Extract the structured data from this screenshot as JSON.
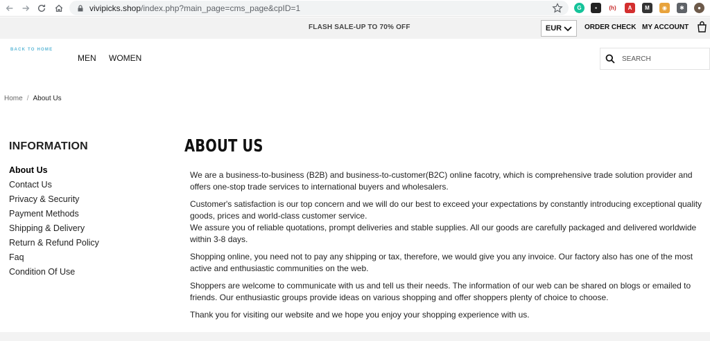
{
  "browser": {
    "url_host": "vivipicks.shop",
    "url_path": "/index.php?main_page=cms_page&cpID=1",
    "extensions": [
      {
        "name": "grammarly-icon",
        "color": "#15c39a",
        "glyph": "G"
      },
      {
        "name": "extension-icon-dark",
        "color": "#222222",
        "glyph": "▪"
      },
      {
        "name": "extension-icon-red-text",
        "color": "#ffffff",
        "glyph": "(h)"
      },
      {
        "name": "pdf-icon",
        "color": "#d32f2f",
        "glyph": "A"
      },
      {
        "name": "m-extension-icon",
        "color": "#333333",
        "glyph": "M"
      },
      {
        "name": "extension-icon-circle",
        "color": "#e8a33c",
        "glyph": "◉"
      },
      {
        "name": "puzzle-extensions-icon",
        "color": "#5f6368",
        "glyph": "✱"
      },
      {
        "name": "profile-avatar-icon",
        "color": "#6d5a4a",
        "glyph": "●"
      }
    ]
  },
  "topbar": {
    "flash_sale": "FLASH SALE-UP TO 70% OFF",
    "currency": "EUR",
    "order_check": "ORDER CHECK",
    "my_account": "MY ACCOUNT"
  },
  "header": {
    "logo_text": "BACK TO HOME",
    "nav": [
      "MEN",
      "WOMEN"
    ],
    "search_placeholder": "SEARCH"
  },
  "breadcrumb": {
    "home": "Home",
    "separator": "/",
    "current": "About Us"
  },
  "sidebar": {
    "title": "INFORMATION",
    "items": [
      {
        "label": "About Us",
        "active": true
      },
      {
        "label": "Contact Us"
      },
      {
        "label": "Privacy & Security"
      },
      {
        "label": "Payment Methods"
      },
      {
        "label": "Shipping & Delivery"
      },
      {
        "label": "Return & Refund Policy"
      },
      {
        "label": "Faq"
      },
      {
        "label": "Condition Of Use"
      }
    ]
  },
  "content": {
    "heading": "ABOUT US",
    "paragraphs": [
      "We are a business-to-business (B2B) and business-to-customer(B2C) online facotry, which is comprehensive trade solution provider and offers one-stop trade services to international buyers and wholesalers.",
      "Customer's satisfaction is our top concern and we will do our best to exceed your expectations by constantly introducing exceptional quality goods, prices and world-class customer service.",
      "We assure you of reliable quotations, prompt deliveries and stable supplies. All our goods are carefully packaged and delivered worldwide within 3-8 days.",
      "Shopping online, you need not to pay any shipping or tax, therefore, we would give you any invoice. Our factory also has one of the most active and enthusiastic communities on the web.",
      "Shoppers are welcome to communicate with us and tell us their needs. The information of our web can be shared on blogs or emailed to friends. Our enthusiastic groups provide ideas on various shopping and offer shoppers plenty of choice to choose.",
      "Thank you for visiting our website and we hope you enjoy your shopping experience with us."
    ]
  }
}
